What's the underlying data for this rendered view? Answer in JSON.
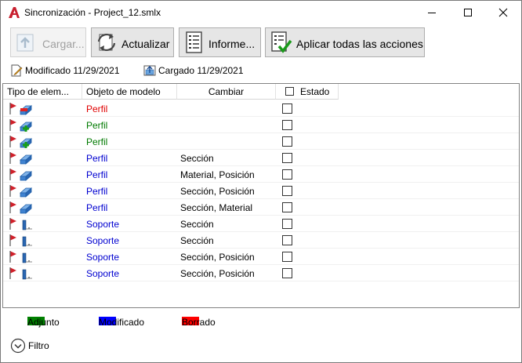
{
  "window": {
    "title": "Sincronización - Project_12.smlx"
  },
  "toolbar": {
    "load_label": "Cargar...",
    "refresh_label": "Actualizar",
    "report_label": "Informe...",
    "apply_all_label": "Aplicar todas las acciones"
  },
  "info": {
    "modified": "Modificado 11/29/2021",
    "loaded": "Cargado 11/29/2021"
  },
  "grid": {
    "headers": {
      "type": "Tipo de elem...",
      "object": "Objeto de modelo",
      "change": "Cambiar",
      "status": "Estado"
    },
    "rows": [
      {
        "icon": "profile-deleted-icon",
        "object": "Perfil",
        "change": "",
        "status": "red"
      },
      {
        "icon": "profile-added-icon",
        "object": "Perfil",
        "change": "",
        "status": "green"
      },
      {
        "icon": "profile-added-icon",
        "object": "Perfil",
        "change": "",
        "status": "green"
      },
      {
        "icon": "profile-modified-icon",
        "object": "Perfil",
        "change": "Sección",
        "status": "blue"
      },
      {
        "icon": "profile-modified-icon",
        "object": "Perfil",
        "change": "Material, Posición",
        "status": "blue"
      },
      {
        "icon": "profile-modified-icon",
        "object": "Perfil",
        "change": "Sección, Posición",
        "status": "blue"
      },
      {
        "icon": "profile-modified-icon",
        "object": "Perfil",
        "change": "Sección, Material",
        "status": "blue"
      },
      {
        "icon": "support-modified-icon",
        "object": "Soporte",
        "change": "Sección",
        "status": "blue"
      },
      {
        "icon": "support-modified-icon",
        "object": "Soporte",
        "change": "Sección",
        "status": "blue"
      },
      {
        "icon": "support-modified-icon",
        "object": "Soporte",
        "change": "Sección, Posición",
        "status": "blue"
      },
      {
        "icon": "support-modified-icon",
        "object": "Soporte",
        "change": "Sección, Posición",
        "status": "blue"
      }
    ]
  },
  "legend": {
    "added": {
      "label": "Adjunto",
      "color": "#008000"
    },
    "modified": {
      "label": "Modificado",
      "color": "#0000ff"
    },
    "deleted": {
      "label": "Borrado",
      "color": "#ff0000"
    }
  },
  "filter": {
    "label": "Filtro"
  },
  "colors": {
    "green": "#007a00",
    "red": "#e00000",
    "blue": "#0000d0",
    "app_icon": "#c8202f"
  }
}
